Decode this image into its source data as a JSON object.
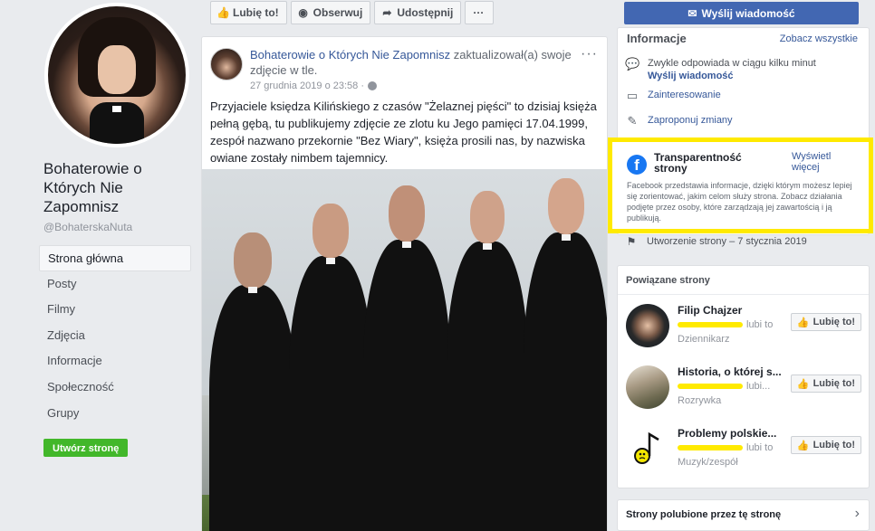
{
  "page": {
    "name": "Bohaterowie o Których Nie Zapomnisz",
    "handle": "@BohaterskaNuta"
  },
  "nav": {
    "items": [
      "Strona główna",
      "Posty",
      "Filmy",
      "Zdjęcia",
      "Informacje",
      "Społeczność",
      "Grupy"
    ],
    "active_index": 0,
    "create_page": "Utwórz stronę"
  },
  "actions": {
    "like": "Lubię to!",
    "follow": "Obserwuj",
    "share": "Udostępnij",
    "more": "···",
    "send_message": "Wyślij wiadomość"
  },
  "post": {
    "author": "Bohaterowie o Których Nie Zapomnisz",
    "action": " zaktualizował(a) swoje zdjęcie w tle.",
    "date": "27 grudnia 2019 o 23:58 ·",
    "more": "···",
    "text": "Przyjaciele księdza Kilińskiego z czasów \"Żelaznej pięści\" to dzisiaj księża pełną gębą, tu publikujemy zdjęcie ze zlotu ku Jego pamięci 17.04.1999, zespół nazwano przekornie \"Bez Wiary\", księża prosili nas, by nazwiska owiane zostały nimbem tajemnicy."
  },
  "info": {
    "title": "Informacje",
    "see_all": "Zobacz wszystkie",
    "response_time": "Zwykle odpowiada w ciągu kilku minut",
    "send_message": "Wyślij wiadomość",
    "category": "Zainteresowanie",
    "suggest": "Zaproponuj zmiany"
  },
  "transparency": {
    "title": "Transparentność strony",
    "show_more": "Wyświetl więcej",
    "description": "Facebook przedstawia informacje, dzięki którym możesz lepiej się zorientować, jakim celom służy strona. Zobacz działania podjęte przez osoby, które zarządzają jej zawartością i ją publikują.",
    "highlight_color": "#ffea00"
  },
  "created": "Utworzenie strony – 7 stycznia 2019",
  "related": {
    "title": "Powiązane strony",
    "items": [
      {
        "name": "Filip Chajzer",
        "likes_suffix": "lubi to",
        "category": "Dziennikarz",
        "like": "Lubię to!"
      },
      {
        "name": "Historia, o której s...",
        "likes_suffix": "lubi...",
        "category": "Rozrywka",
        "like": "Lubię to!"
      },
      {
        "name": "Problemy polskie...",
        "likes_suffix": "lubi to",
        "category": "Muzyk/zespół",
        "like": "Lubię to!"
      }
    ]
  },
  "liked_by_page": "Strony polubione przez tę stronę",
  "colors": {
    "brand": "#4267b2",
    "link": "#365899",
    "green": "#42b72a",
    "background": "#e9ebee"
  }
}
